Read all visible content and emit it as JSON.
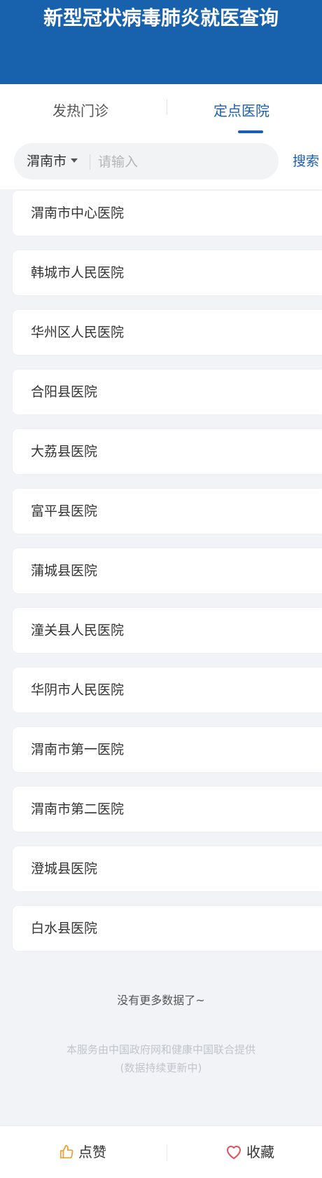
{
  "header": {
    "title": "新型冠状病毒肺炎就医查询"
  },
  "tabs": [
    {
      "label": "发热门诊",
      "active": false
    },
    {
      "label": "定点医院",
      "active": true
    }
  ],
  "search": {
    "city": "渭南市",
    "placeholder": "请输入",
    "value": "",
    "button_label": "搜索"
  },
  "hospitals": [
    "渭南市中心医院",
    "韩城市人民医院",
    "华州区人民医院",
    "合阳县医院",
    "大荔县医院",
    "富平县医院",
    "蒲城县医院",
    "潼关县人民医院",
    "华阴市人民医院",
    "渭南市第一医院",
    "渭南市第二医院",
    "澄城县医院",
    "白水县医院"
  ],
  "no_more_text": "没有更多数据了~",
  "footer_note": {
    "line1": "本服务由中国政府网和健康中国联合提供",
    "line2": "(数据持续更新中)"
  },
  "bottom_bar": {
    "like_label": "点赞",
    "favorite_label": "收藏"
  },
  "colors": {
    "header_bg": "#1761ad",
    "accent": "#1a5fb4",
    "like_icon": "#e8a23c",
    "favorite_icon": "#e0505a"
  },
  "icons": {
    "like": "thumbs-up-icon",
    "favorite": "heart-icon",
    "city_caret": "caret-down-icon"
  }
}
